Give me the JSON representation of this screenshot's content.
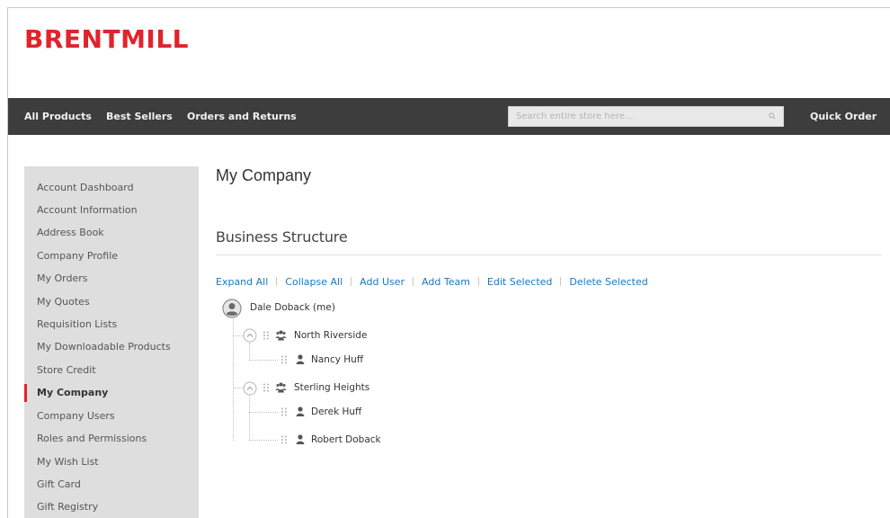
{
  "header": {
    "logo": "BRENTMILL"
  },
  "nav": {
    "items": [
      "All Products",
      "Best Sellers",
      "Orders and Returns"
    ],
    "search_placeholder": "Search entire store here...",
    "quick_order": "Quick Order"
  },
  "sidebar": {
    "items": [
      "Account Dashboard",
      "Account Information",
      "Address Book",
      "Company Profile",
      "My Orders",
      "My Quotes",
      "Requisition Lists",
      "My Downloadable Products",
      "Store Credit",
      "My Company",
      "Company Users",
      "Roles and Permissions",
      "My Wish List",
      "Gift Card",
      "Gift Registry"
    ],
    "active": "My Company"
  },
  "main": {
    "title": "My Company",
    "section": "Business Structure",
    "actions": [
      "Expand All",
      "Collapse All",
      "Add User",
      "Add Team",
      "Edit Selected",
      "Delete Selected"
    ],
    "tree": {
      "root": "Dale Doback (me)",
      "teams": [
        {
          "name": "North Riverside",
          "users": [
            "Nancy Huff"
          ]
        },
        {
          "name": "Sterling Heights",
          "users": [
            "Derek Huff",
            "Robert Doback"
          ]
        }
      ]
    }
  },
  "colors": {
    "brand": "#e0242b",
    "nav_bg": "#3d3d3d",
    "link": "#1979c3",
    "sidebar_bg": "#dedede"
  },
  "icons": {
    "root": "user-avatar-icon",
    "team": "team-icon",
    "user": "user-icon",
    "toggle": "collapse-chevron-icon",
    "drag": "drag-handle-icon",
    "search": "search-icon"
  }
}
